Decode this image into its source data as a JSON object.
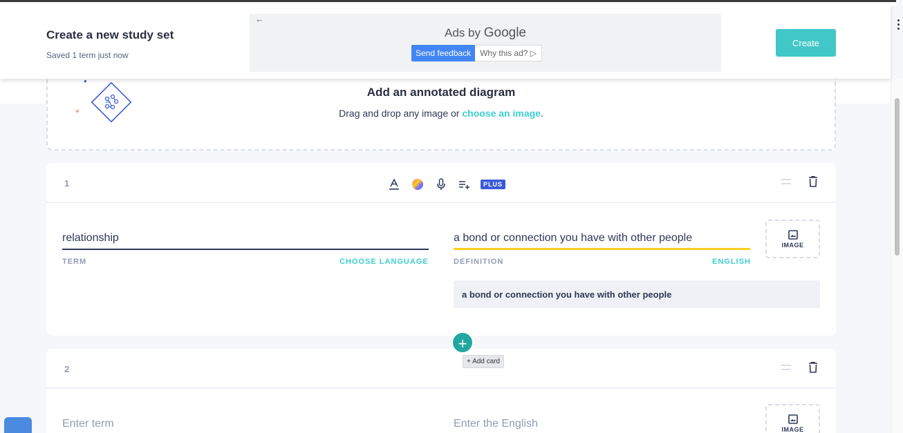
{
  "header": {
    "title": "Create a new study set",
    "subtitle": "Saved 1 term just now",
    "create_label": "Create"
  },
  "ad": {
    "back_arrow": "←",
    "ads_by": "Ads by",
    "google": "Google",
    "send_feedback": "Send feedback",
    "why_this_ad": "Why this ad? ▷"
  },
  "diagram": {
    "title": "Add an annotated diagram",
    "text_before": "Drag and drop any image or",
    "link": "choose an image",
    "text_after": ".",
    "icon": "diagram-icon"
  },
  "toolbar": {
    "plus_badge": "PLUS",
    "icons": [
      "text-format-icon",
      "color-palette-icon",
      "microphone-icon",
      "add-list-icon"
    ]
  },
  "cards": [
    {
      "number": "1",
      "term": "relationship",
      "term_label": "TERM",
      "term_language": "CHOOSE LANGUAGE",
      "definition": "a bond or connection you have with other people",
      "definition_label": "DEFINITION",
      "definition_language": "ENGLISH",
      "image_label": "IMAGE",
      "suggestion": "a bond or connection you have with other people"
    },
    {
      "number": "2",
      "term_placeholder": "Enter term",
      "definition_placeholder": "Enter the English",
      "image_label": "IMAGE"
    }
  ],
  "add_card": {
    "plus": "+",
    "tooltip": "+ Add card"
  },
  "colors": {
    "accent": "#41c7c7",
    "link": "#3ccfcf",
    "definition_underline": "#ffcd1f",
    "add_button": "#22a8a0",
    "plus_badge": "#3b5bd6"
  }
}
